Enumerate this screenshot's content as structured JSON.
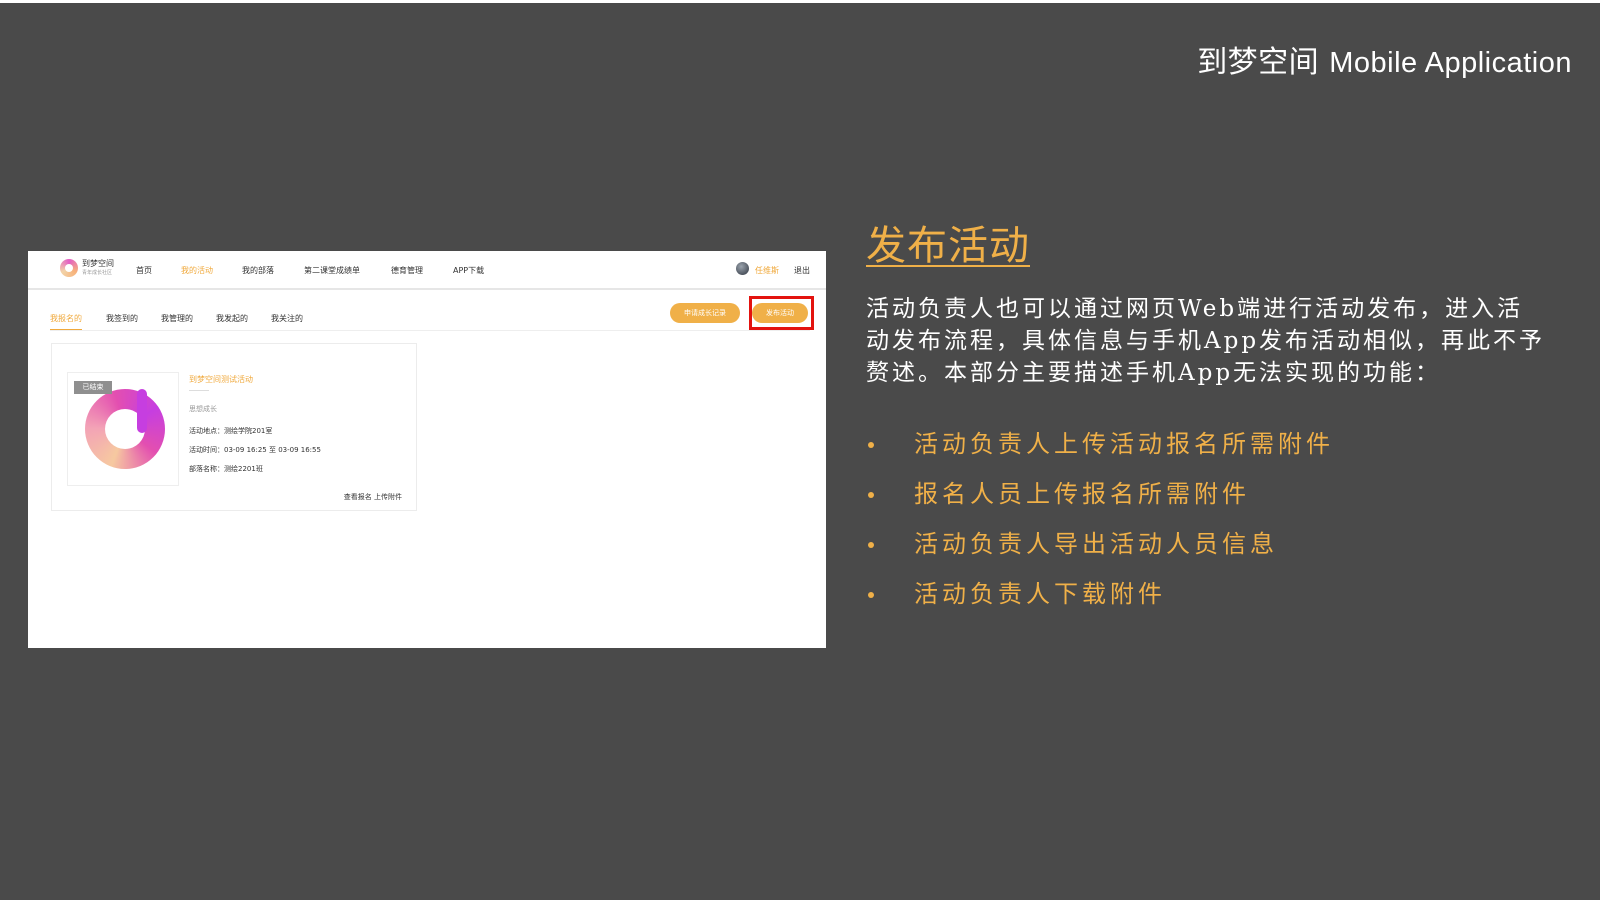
{
  "slide": {
    "header": "到梦空间",
    "header_en": "Mobile Application"
  },
  "screenshot": {
    "logo_text": "到梦空间",
    "logo_sub": "青年成长社区",
    "nav": [
      "首页",
      "我的活动",
      "我的部落",
      "第二课堂成绩单",
      "德育管理",
      "APP下载"
    ],
    "active_nav_index": 1,
    "username": "任维斯",
    "logout": "退出",
    "subtabs": [
      "我报名的",
      "我签到的",
      "我管理的",
      "我发起的",
      "我关注的"
    ],
    "active_subtab_index": 0,
    "apply_button": "申请成长记录",
    "publish_button": "发布活动",
    "card": {
      "badge": "已结束",
      "title": "到梦空间测试活动",
      "category": "思想成长",
      "location": "活动地点：测绘学院201室",
      "time": "活动时间：03-09 16:25 至 03-09 16:55",
      "department": "部落名称：测绘2201班",
      "view_signup": "查看报名",
      "upload_attachment": "上传附件"
    }
  },
  "content": {
    "title": "发布活动",
    "description": "活动负责人也可以通过网页Web端进行活动发布，进入活动发布流程，具体信息与手机App发布活动相似，再此不予赘述。本部分主要描述手机App无法实现的功能：",
    "bullets": [
      "活动负责人上传活动报名所需附件",
      "报名人员上传报名所需附件",
      "活动负责人导出活动人员信息",
      "活动负责人下载附件"
    ]
  },
  "colors": {
    "slide_bg": "#4a4a4a",
    "accent": "#f0b048",
    "highlight": "#e3130f"
  }
}
